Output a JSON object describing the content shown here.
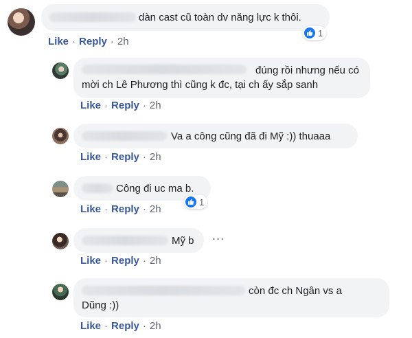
{
  "comments": [
    {
      "text": "dàn cast cũ toàn dv năng lực k thôi.",
      "actions": {
        "like": "Like",
        "reply": "Reply",
        "time": "2h",
        "dot": "·"
      },
      "reaction_count": "1"
    },
    {
      "text_line1": "đúng rồi nhưng nếu có",
      "text_line2": "mời ch Lê Phương thì cũng k đc, tại ch ấy sắp sanh",
      "actions": {
        "like": "Like",
        "reply": "Reply",
        "time": "2h",
        "dot": "·"
      }
    },
    {
      "text": "Va a công cũng đã đi Mỹ :)) thuaaa",
      "actions": {
        "like": "Like",
        "reply": "Reply",
        "time": "2h",
        "dot": "·"
      }
    },
    {
      "text": "Công đi uc ma b.",
      "actions": {
        "like": "Like",
        "reply": "Reply",
        "time": "2h",
        "dot": "·"
      },
      "reaction_count": "1"
    },
    {
      "text": "Mỹ b",
      "more": "···",
      "actions": {
        "like": "Like",
        "reply": "Reply",
        "time": "2h",
        "dot": "·"
      }
    },
    {
      "text_line1": "còn đc ch Ngân vs a",
      "text_line2": "Dũng :))",
      "actions": {
        "like": "Like",
        "reply": "Reply",
        "time": "2h",
        "dot": "·"
      }
    }
  ],
  "colors": {
    "link": "#385898",
    "bubble": "#f2f3f5",
    "like_blue": "#1877f2",
    "meta": "#606770"
  },
  "icons": {
    "reaction": "like-reaction-icon",
    "more": "more-options-icon"
  }
}
